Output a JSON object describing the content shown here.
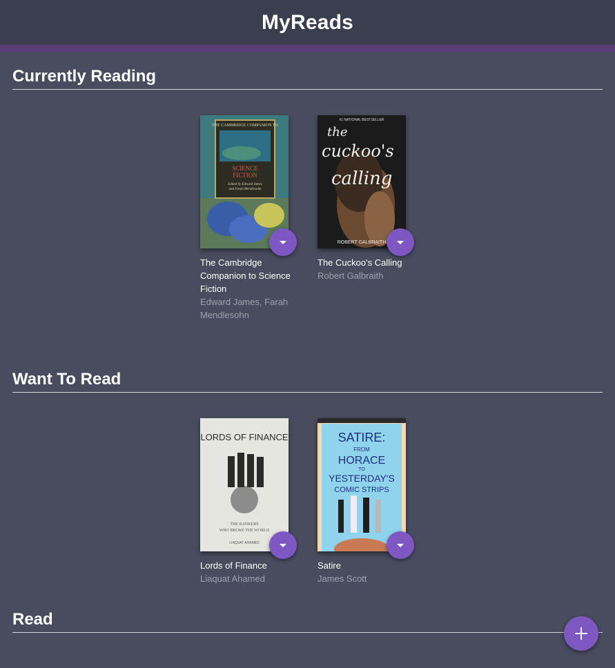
{
  "app": {
    "title": "MyReads"
  },
  "colors": {
    "accent": "#7e57c2",
    "header_stripe": "#5b3b78",
    "background": "#484c5e"
  },
  "shelves": [
    {
      "title": "Currently Reading",
      "books": [
        {
          "title": "The Cambridge Companion to Science Fiction",
          "authors": "Edward James, Farah Mendlesohn",
          "cover_text": [
            "THE CAMBRIDGE COMPANION TO",
            "SCIENCE",
            "FICTION",
            "Edited by Edward James",
            "and Farah Mendlesohn"
          ]
        },
        {
          "title": "The Cuckoo's Calling",
          "authors": "Robert Galbraith",
          "cover_text": [
            "#1 NATIONAL BESTSELLER",
            "the",
            "cuckoo's",
            "calling",
            "ROBERT GALBRAITH"
          ]
        }
      ]
    },
    {
      "title": "Want To Read",
      "books": [
        {
          "title": "Lords of Finance",
          "authors": "Liaquat Ahamed",
          "cover_text": [
            "LORDS OF FINANCE",
            "THE BANKERS",
            "WHO BROKE THE WORLD",
            "LIAQUAT AHAMED"
          ]
        },
        {
          "title": "Satire",
          "authors": "James Scott",
          "cover_text": [
            "SATIRE:",
            "FROM",
            "HORACE",
            "TO",
            "YESTERDAY'S",
            "COMIC STRIPS"
          ]
        }
      ]
    },
    {
      "title": "Read",
      "books": []
    }
  ],
  "icons": {
    "shelf_changer": "caret-down-icon",
    "add": "plus-icon"
  }
}
